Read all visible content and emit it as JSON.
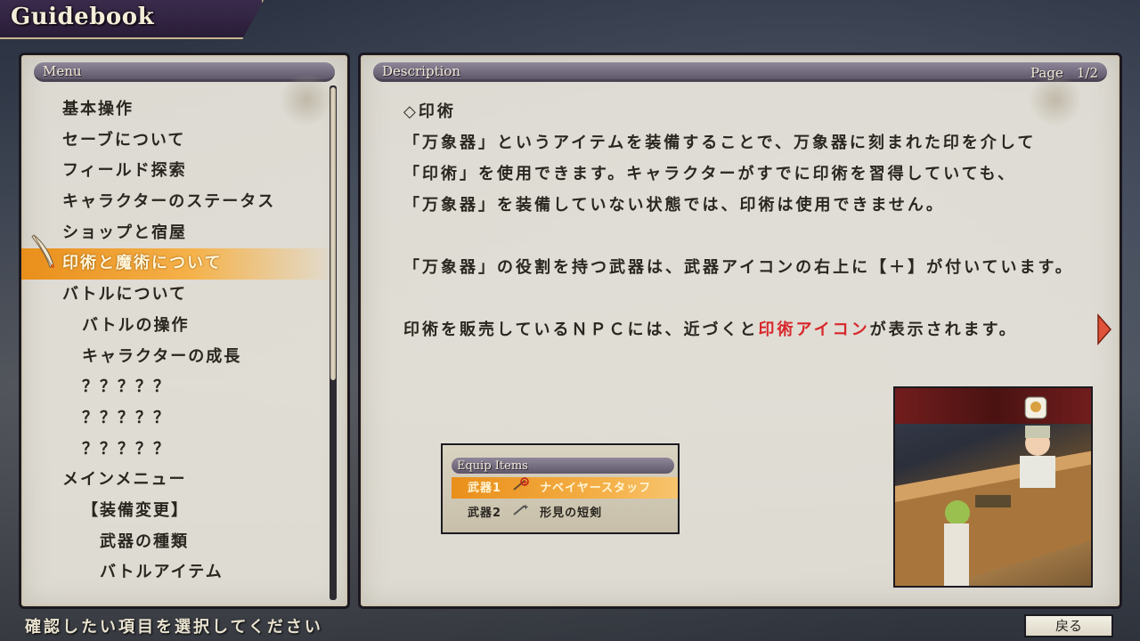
{
  "title": "Guidebook",
  "menu": {
    "header": "Menu",
    "items": [
      {
        "label": "基本操作",
        "level": 0
      },
      {
        "label": "セーブについて",
        "level": 0
      },
      {
        "label": "フィールド探索",
        "level": 0
      },
      {
        "label": "キャラクターのステータス",
        "level": 0
      },
      {
        "label": "ショップと宿屋",
        "level": 0
      },
      {
        "label": "印術と魔術について",
        "level": 0,
        "selected": true
      },
      {
        "label": "バトルについて",
        "level": 0
      },
      {
        "label": "バトルの操作",
        "level": 1
      },
      {
        "label": "キャラクターの成長",
        "level": 1
      },
      {
        "label": "？？？？？",
        "level": 1
      },
      {
        "label": "？？？？？",
        "level": 1
      },
      {
        "label": "？？？？？",
        "level": 1
      },
      {
        "label": "メインメニュー",
        "level": 0
      },
      {
        "label": "【装備変更】",
        "level": 1
      },
      {
        "label": "武器の種類",
        "level": 2
      },
      {
        "label": "バトルアイテム",
        "level": 2
      }
    ],
    "scroll_fraction": 0.57
  },
  "description": {
    "header": "Description",
    "page": "Page　1/2",
    "heading": "◇印術",
    "line1": "「万象器」というアイテムを装備することで、万象器に刻まれた印を介して",
    "line2": "「印術」を使用できます。キャラクターがすでに印術を習得していても、",
    "line3": "「万象器」を装備していない状態では、印術は使用できません。",
    "line4": "「万象器」の役割を持つ武器は、武器アイコンの右上に【＋】が付いています。",
    "line5_pre": "印術を販売しているＮＰＣには、近づくと",
    "line5_red": "印術アイコン",
    "line5_post": "が表示されます。",
    "equip_inset": {
      "header": "Equip Items",
      "rows": [
        {
          "slot": "武器1",
          "item": "ナベイヤースタッフ"
        },
        {
          "slot": "武器2",
          "item": "形見の短剣"
        }
      ]
    }
  },
  "footer": {
    "hint": "確認したい項目を選択してください",
    "back_label": "戻る"
  },
  "colors": {
    "highlight": "#e98e1a",
    "accent_red": "#d8262b",
    "panel_bg": "#ece8de"
  }
}
